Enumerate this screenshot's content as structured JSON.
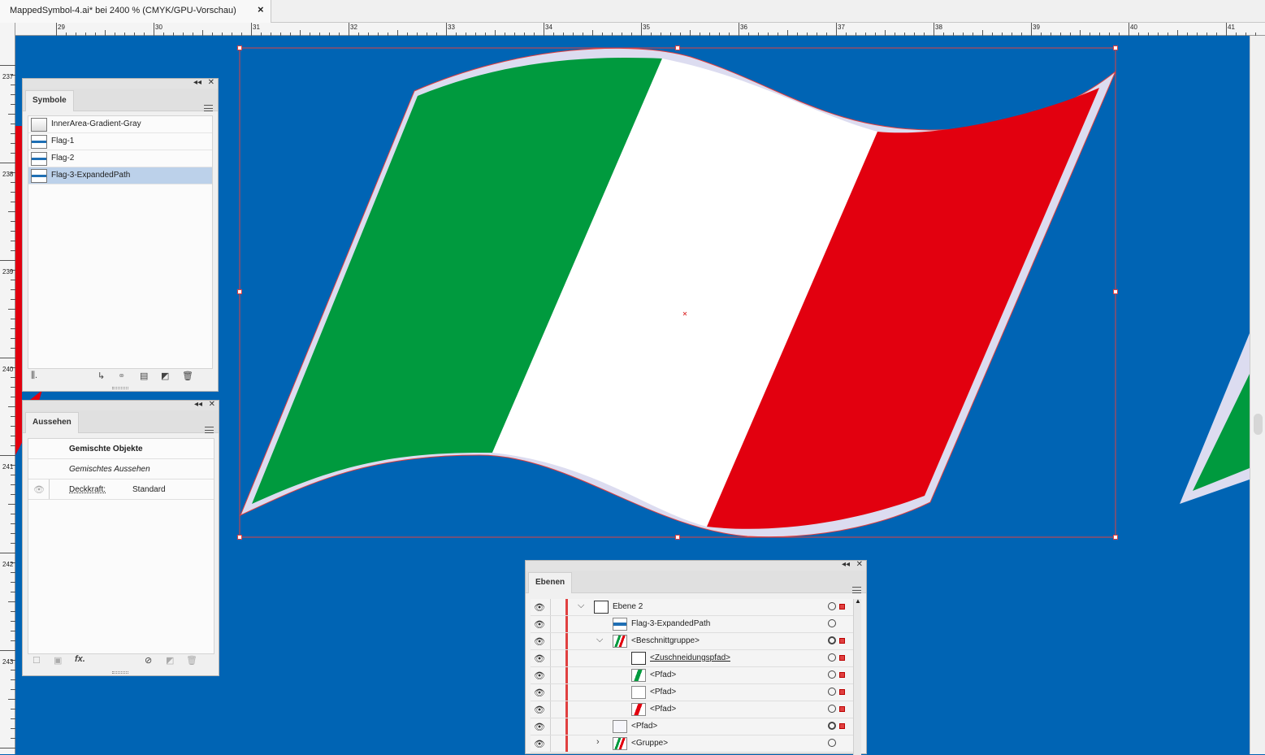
{
  "document": {
    "tab_title": "MappedSymbol-4.ai* bei 2400 % (CMYK/GPU-Vorschau)",
    "close_glyph": "×"
  },
  "ruler": {
    "horizontal_labels": [
      "29",
      "30",
      "31",
      "32",
      "33",
      "34",
      "35",
      "36",
      "37",
      "38",
      "39",
      "40",
      "41"
    ],
    "vertical_labels": [
      "237",
      "238",
      "239",
      "240",
      "241",
      "242",
      "243"
    ]
  },
  "colors": {
    "canvas_blue": "#0064b4",
    "flag_green": "#009a3e",
    "flag_white": "#ffffff",
    "flag_red": "#e2000f",
    "border_lavender": "#dcdcf0",
    "selection_red": "#e04040"
  },
  "symbols_panel": {
    "tab": "Symbole",
    "items": [
      {
        "label": "InnerArea-Gradient-Gray",
        "selected": false
      },
      {
        "label": "Flag-1",
        "selected": false
      },
      {
        "label": "Flag-2",
        "selected": false
      },
      {
        "label": "Flag-3-ExpandedPath",
        "selected": true
      }
    ],
    "footer_icons": [
      "symbol-libraries-icon",
      "place-symbol-icon",
      "break-link-icon",
      "symbol-options-icon",
      "new-symbol-icon",
      "delete-icon"
    ]
  },
  "appearance_panel": {
    "tab": "Aussehen",
    "header": "Gemischte Objekte",
    "subheader": "Gemischtes Aussehen",
    "opacity_label": "Deckkraft:",
    "opacity_value": "Standard",
    "fx_label": "fx."
  },
  "layers_panel": {
    "tab": "Ebenen",
    "rows": [
      {
        "label": "Ebene 2",
        "expanded": true
      },
      {
        "label": "Flag-3-ExpandedPath"
      },
      {
        "label": "<Beschnittgruppe>",
        "expanded": true
      },
      {
        "label": "<Zuschneidungspfad>"
      },
      {
        "label": "<Pfad>"
      },
      {
        "label": "<Pfad>"
      },
      {
        "label": "<Pfad>"
      },
      {
        "label": "<Pfad>"
      },
      {
        "label": "<Gruppe>",
        "expanded": false
      }
    ]
  }
}
